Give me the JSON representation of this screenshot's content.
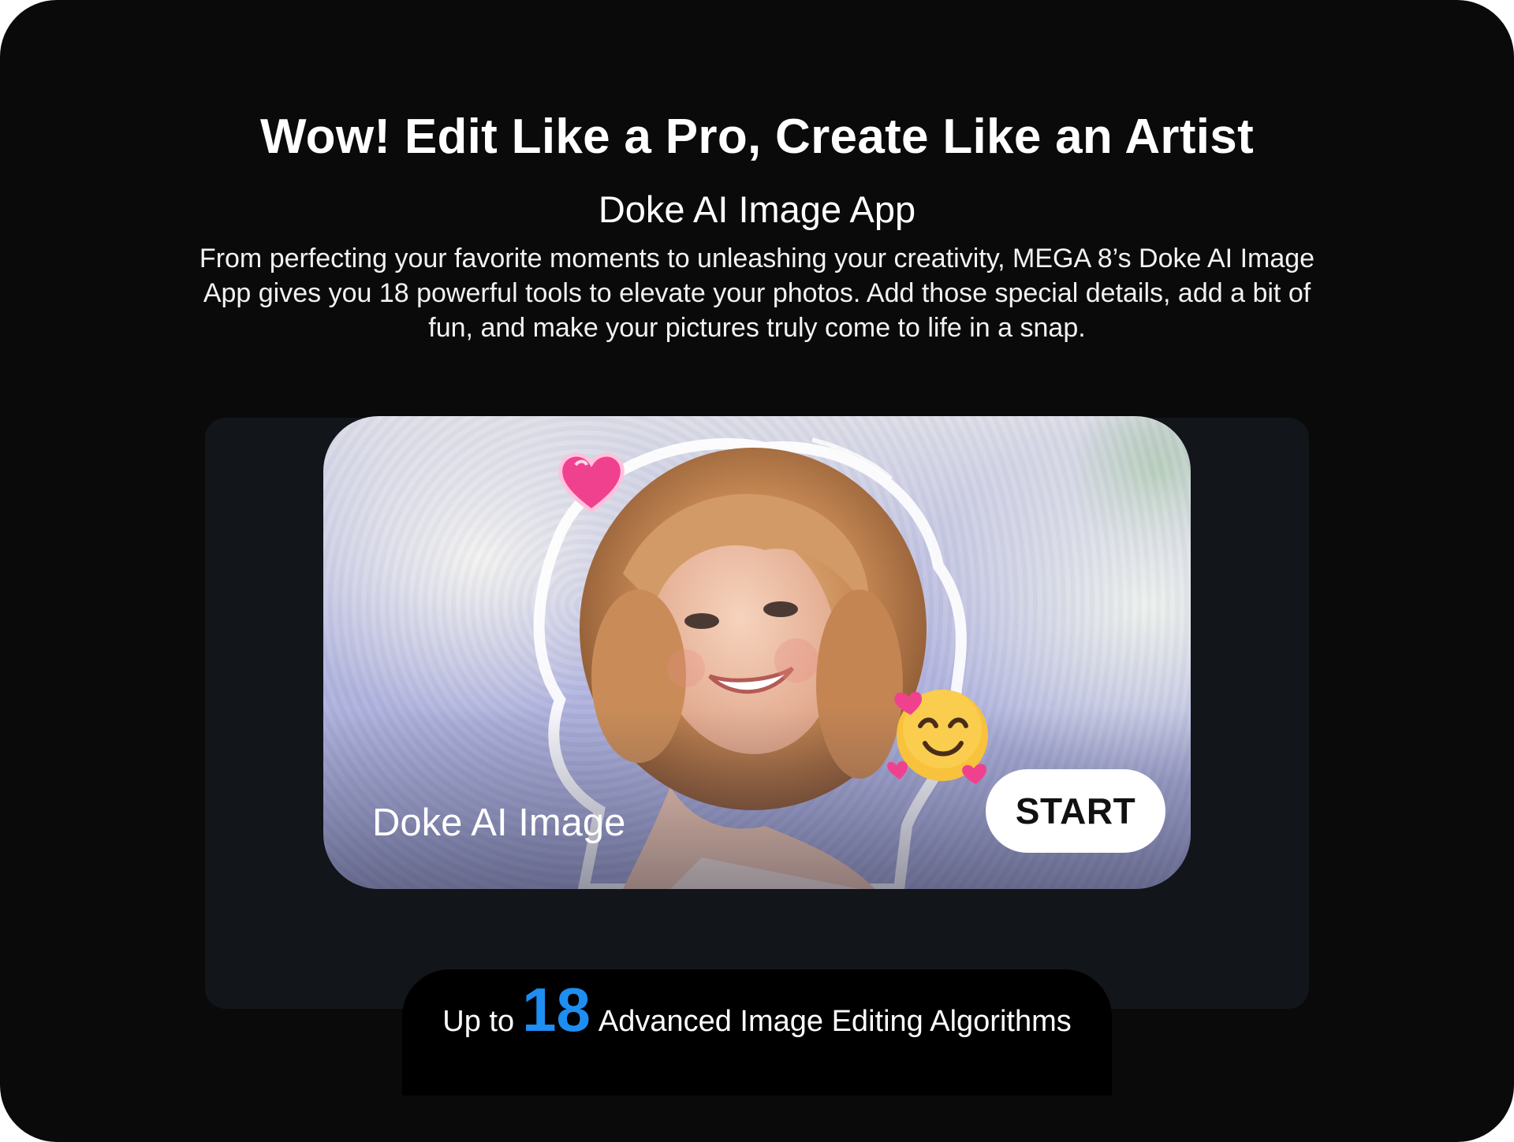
{
  "hero": {
    "headline": "Wow! Edit Like a Pro, Create Like an Artist",
    "subheadline": "Doke AI Image App",
    "description": "From perfecting your favorite moments to unleashing your creativity, MEGA 8’s Doke AI Image App gives you 18 powerful tools to elevate your photos. Add those special details, add a bit of fun, and make your pictures truly come to life in a snap."
  },
  "app_card": {
    "label": "Doke AI Image",
    "start_label": "START"
  },
  "feature": {
    "prefix": "Up to",
    "count": "18",
    "suffix": "Advanced Image Editing Algorithms"
  },
  "colors": {
    "background": "#0a0a0b",
    "accent": "#1e8ef2",
    "button": "#ffffff"
  },
  "icons": [
    "heart-icon",
    "smiling-face-with-hearts-icon"
  ]
}
